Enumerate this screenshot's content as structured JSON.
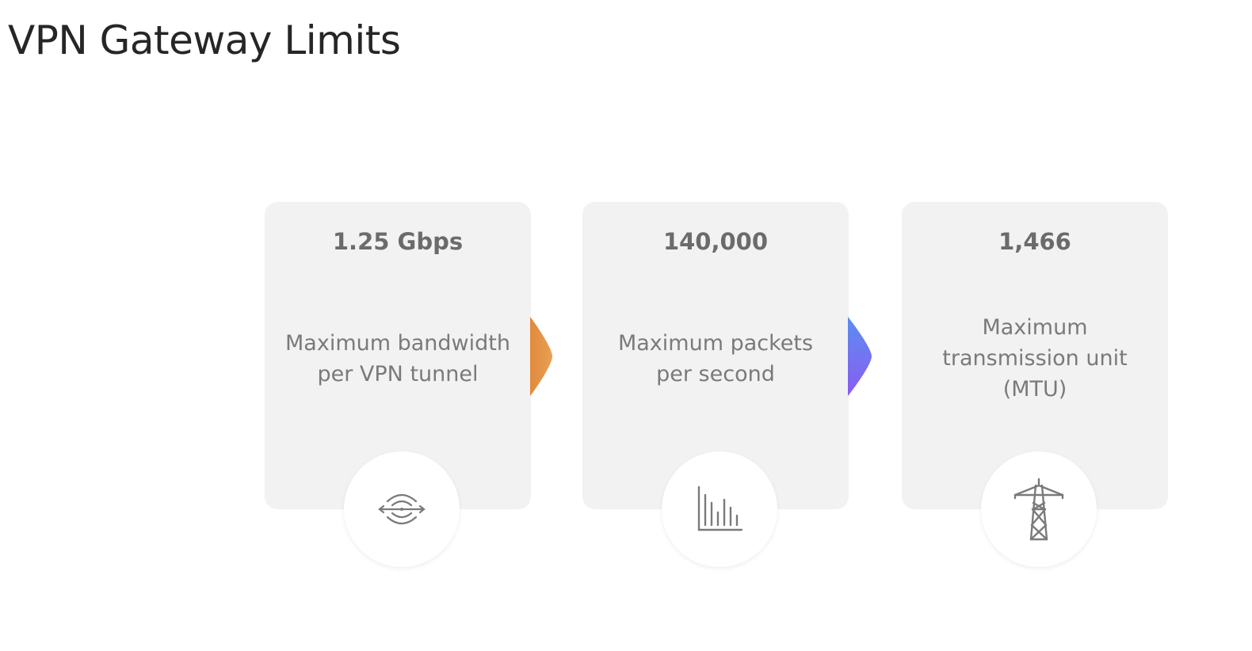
{
  "page": {
    "title": "VPN Gateway Limits"
  },
  "cards": [
    {
      "value": "1.25 Gbps",
      "label": "Maximum bandwidth per VPN tunnel",
      "icon": "wireless-signal-icon"
    },
    {
      "value": "140,000",
      "label": "Maximum packets per second",
      "icon": "bar-chart-icon"
    },
    {
      "value": "1,466",
      "label": "Maximum transmission unit (MTU)",
      "icon": "transmission-tower-icon"
    }
  ],
  "colors": {
    "card_background": "#f2f2f2",
    "connector_1_start": "#e08a3c",
    "connector_1_end": "#e8a055",
    "connector_2_start": "#5b8ef0",
    "connector_2_end": "#8a5cf0",
    "value_text": "#6b6b6b",
    "label_text": "#7a7a7a"
  }
}
